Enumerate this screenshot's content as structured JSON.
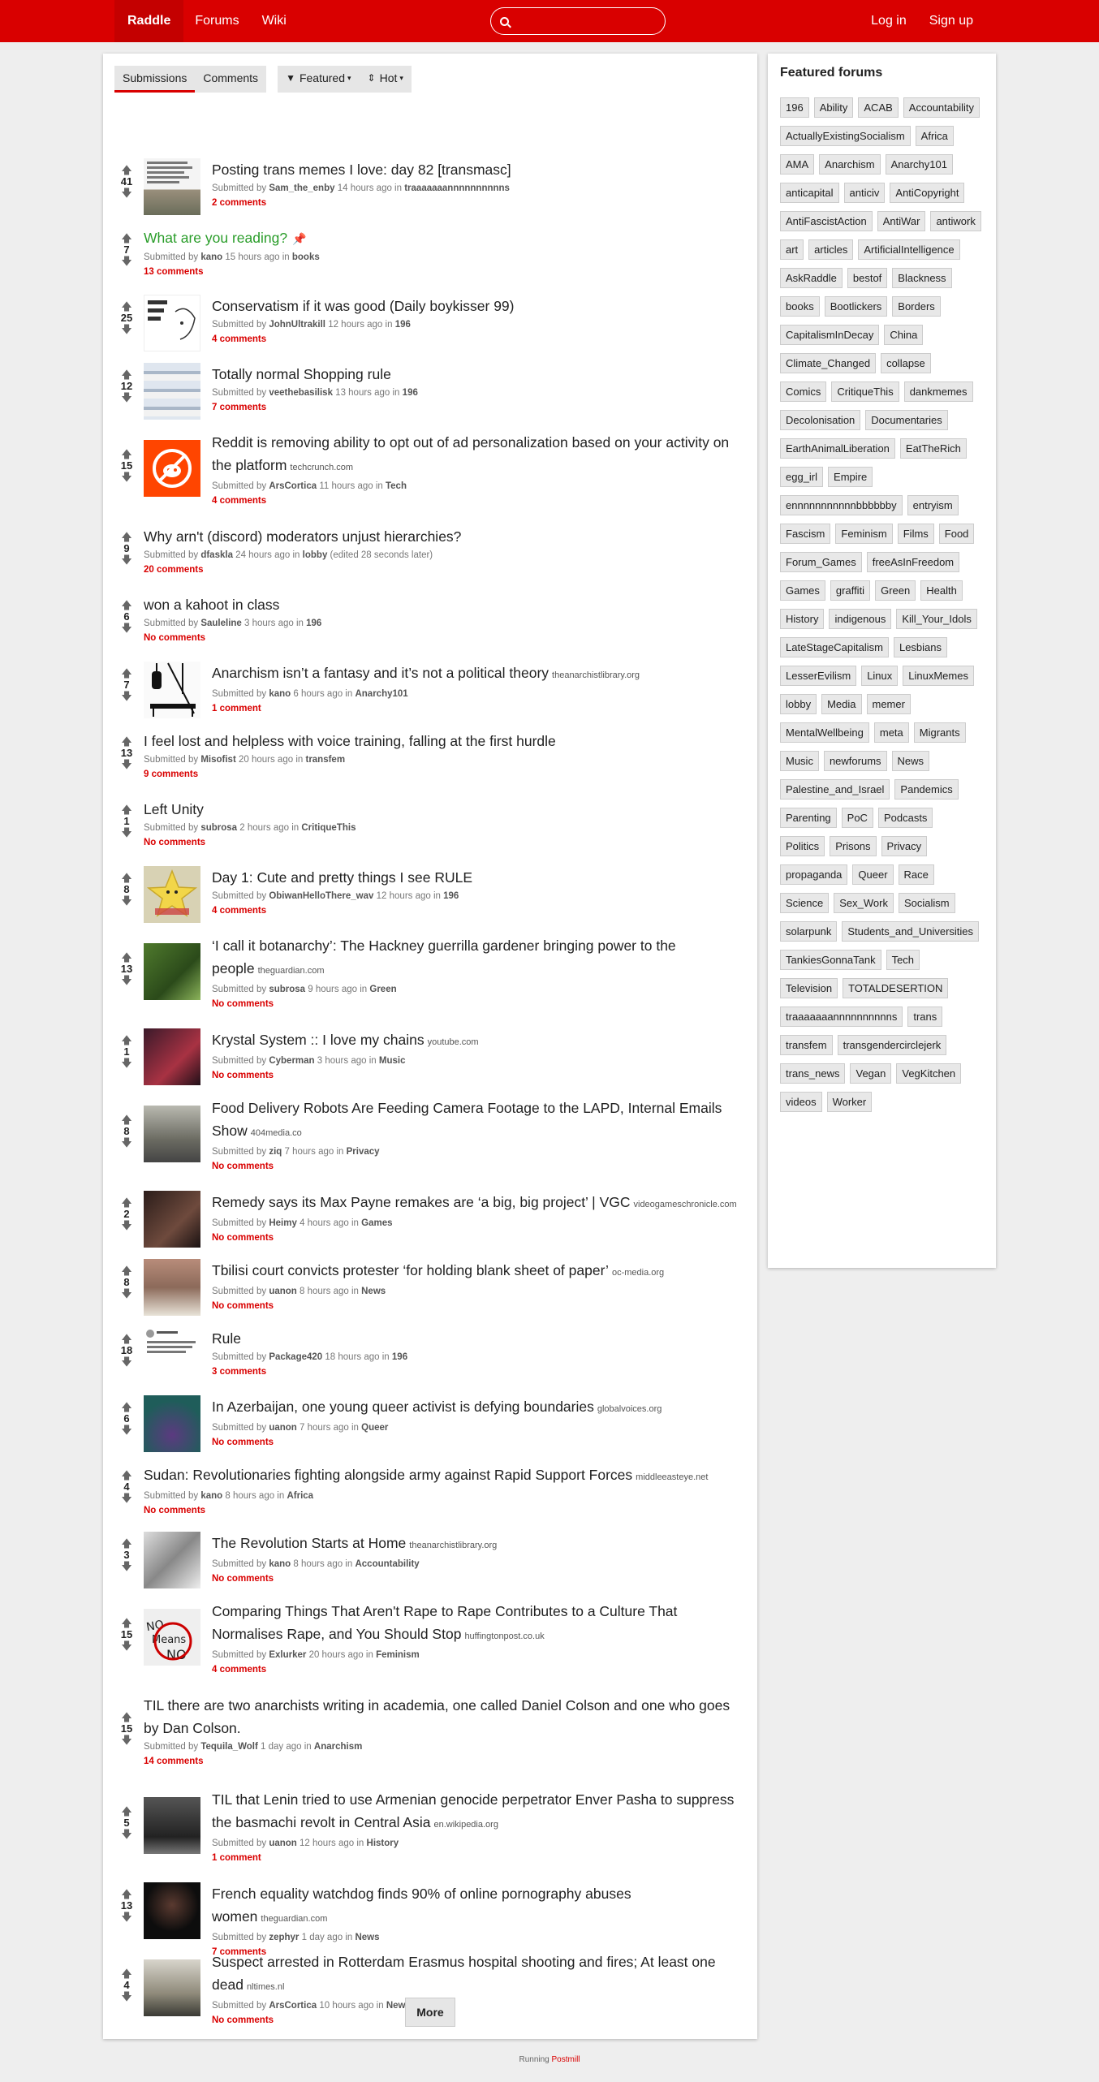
{
  "nav": {
    "brand": "Raddle",
    "forums": "Forums",
    "wiki": "Wiki",
    "login": "Log in",
    "signup": "Sign up",
    "search_placeholder": ""
  },
  "tabs": {
    "submissions": "Submissions",
    "comments": "Comments",
    "featured": "Featured",
    "hot": "Hot"
  },
  "posts": [
    {
      "score": "41",
      "title": "Posting trans memes I love: day 82 [transmasc]",
      "domain": "",
      "submitted": "Submitted by",
      "user": "Sam_the_enby",
      "time": "14 hours ago in",
      "forum": "traaaaaaannnnnnnnnns",
      "edited": "",
      "comments": "2 comments",
      "thumb": "memes"
    },
    {
      "score": "7",
      "title": "What are you reading?",
      "domain": "",
      "submitted": "Submitted by",
      "user": "kano",
      "time": "15 hours ago in",
      "forum": "books",
      "edited": "",
      "comments": "13 comments",
      "thumb": "",
      "pinned": true
    },
    {
      "score": "25",
      "title": "Conservatism if it was good (Daily boykisser 99)",
      "domain": "",
      "submitted": "Submitted by",
      "user": "JohnUltrakill",
      "time": "12 hours ago in",
      "forum": "196",
      "edited": "",
      "comments": "4 comments",
      "thumb": "sketch"
    },
    {
      "score": "12",
      "title": "Totally normal Shopping rule",
      "domain": "",
      "submitted": "Submitted by",
      "user": "veethebasilisk",
      "time": "13 hours ago in",
      "forum": "196",
      "edited": "",
      "comments": "7 comments",
      "thumb": "screens"
    },
    {
      "score": "15",
      "title": "Reddit is removing ability to opt out of ad personalization based on your activity on the platform",
      "domain": "techcrunch.com",
      "submitted": "Submitted by",
      "user": "ArsCortica",
      "time": "11 hours ago in",
      "forum": "Tech",
      "edited": "",
      "comments": "4 comments",
      "thumb": "reddit"
    },
    {
      "score": "9",
      "title": "Why arn't (discord) moderators unjust hierarchies?",
      "domain": "",
      "submitted": "Submitted by",
      "user": "dfaskla",
      "time": "24 hours ago in",
      "forum": "lobby",
      "edited": "(edited 28 seconds later)",
      "comments": "20 comments",
      "thumb": ""
    },
    {
      "score": "6",
      "title": "won a kahoot in class",
      "domain": "",
      "submitted": "Submitted by",
      "user": "Sauleline",
      "time": "3 hours ago in",
      "forum": "196",
      "edited": "",
      "comments": "No comments",
      "thumb": ""
    },
    {
      "score": "7",
      "title": "Anarchism isn’t a fantasy and it’s not a political theory",
      "domain": "theanarchistlibrary.org",
      "submitted": "Submitted by",
      "user": "kano",
      "time": "6 hours ago in",
      "forum": "Anarchy101",
      "edited": "",
      "comments": "1 comment",
      "thumb": "bw"
    },
    {
      "score": "13",
      "title": "I feel lost and helpless with voice training, falling at the first hurdle",
      "domain": "",
      "submitted": "Submitted by",
      "user": "Misofist",
      "time": "20 hours ago in",
      "forum": "transfem",
      "edited": "",
      "comments": "9 comments",
      "thumb": ""
    },
    {
      "score": "1",
      "title": "Left Unity",
      "domain": "",
      "submitted": "Submitted by",
      "user": "subrosa",
      "time": "2 hours ago in",
      "forum": "CritiqueThis",
      "edited": "",
      "comments": "No comments",
      "thumb": ""
    },
    {
      "score": "8",
      "title": "Day 1: Cute and pretty things I see RULE",
      "domain": "",
      "submitted": "Submitted by",
      "user": "ObiwanHelloThere_wav",
      "time": "12 hours ago in",
      "forum": "196",
      "edited": "",
      "comments": "4 comments",
      "thumb": "star"
    },
    {
      "score": "13",
      "title": "‘I call it botanarchy’: The Hackney guerrilla gardener bringing power to the people",
      "domain": "theguardian.com",
      "submitted": "Submitted by",
      "user": "subrosa",
      "time": "9 hours ago in",
      "forum": "Green",
      "edited": "",
      "comments": "No comments",
      "thumb": "garden"
    },
    {
      "score": "1",
      "title": "Krystal System :: I love my chains",
      "domain": "youtube.com",
      "submitted": "Submitted by",
      "user": "Cyberman",
      "time": "3 hours ago in",
      "forum": "Music",
      "edited": "",
      "comments": "No comments",
      "thumb": "music"
    },
    {
      "score": "8",
      "title": "Food Delivery Robots Are Feeding Camera Footage to the LAPD, Internal Emails Show",
      "domain": "404media.co",
      "submitted": "Submitted by",
      "user": "ziq",
      "time": "7 hours ago in",
      "forum": "Privacy",
      "edited": "",
      "comments": "No comments",
      "thumb": "robots"
    },
    {
      "score": "2",
      "title": "Remedy says its Max Payne remakes are ‘a big, big project’ | VGC",
      "domain": "videogameschronicle.com",
      "submitted": "Submitted by",
      "user": "Heimy",
      "time": "4 hours ago in",
      "forum": "Games",
      "edited": "",
      "comments": "No comments",
      "thumb": "game"
    },
    {
      "score": "8",
      "title": "Tbilisi court convicts protester ‘for holding blank sheet of paper’",
      "domain": "oc-media.org",
      "submitted": "Submitted by",
      "user": "uanon",
      "time": "8 hours ago in",
      "forum": "News",
      "edited": "",
      "comments": "No comments",
      "thumb": "protest"
    },
    {
      "score": "18",
      "title": "Rule",
      "domain": "",
      "submitted": "Submitted by",
      "user": "Package420",
      "time": "18 hours ago in",
      "forum": "196",
      "edited": "",
      "comments": "3 comments",
      "thumb": "tweet"
    },
    {
      "score": "6",
      "title": "In Azerbaijan, one young queer activist is defying boundaries",
      "domain": "globalvoices.org",
      "submitted": "Submitted by",
      "user": "uanon",
      "time": "7 hours ago in",
      "forum": "Queer",
      "edited": "",
      "comments": "No comments",
      "thumb": "queer"
    },
    {
      "score": "4",
      "title": "Sudan: Revolutionaries fighting alongside army against Rapid Support Forces",
      "domain": "middleeasteye.net",
      "submitted": "Submitted by",
      "user": "kano",
      "time": "8 hours ago in",
      "forum": "Africa",
      "edited": "",
      "comments": "No comments",
      "thumb": ""
    },
    {
      "score": "3",
      "title": "The Revolution Starts at Home",
      "domain": "theanarchistlibrary.org",
      "submitted": "Submitted by",
      "user": "kano",
      "time": "8 hours ago in",
      "forum": "Accountability",
      "edited": "",
      "comments": "No comments",
      "thumb": "bw2"
    },
    {
      "score": "15",
      "title": "Comparing Things That Aren't Rape to Rape Contributes to a Culture That Normalises Rape, and You Should Stop",
      "domain": "huffingtonpost.co.uk",
      "submitted": "Submitted by",
      "user": "Exlurker",
      "time": "20 hours ago in",
      "forum": "Feminism",
      "edited": "",
      "comments": "4 comments",
      "thumb": "nomeans"
    },
    {
      "score": "15",
      "title": "TIL there are two anarchists writing in academia, one called Daniel Colson and one who goes by Dan Colson.",
      "domain": "",
      "submitted": "Submitted by",
      "user": "Tequila_Wolf",
      "time": "1 day ago in",
      "forum": "Anarchism",
      "edited": "",
      "comments": "14 comments",
      "thumb": ""
    },
    {
      "score": "5",
      "title": "TIL that Lenin tried to use Armenian genocide perpetrator Enver Pasha to suppress the basmachi revolt in Central Asia",
      "domain": "en.wikipedia.org",
      "submitted": "Submitted by",
      "user": "uanon",
      "time": "12 hours ago in",
      "forum": "History",
      "edited": "",
      "comments": "1 comment",
      "thumb": "portrait"
    },
    {
      "score": "13",
      "title": "French equality watchdog finds 90% of online pornography abuses women",
      "domain": "theguardian.com",
      "submitted": "Submitted by",
      "user": "zephyr",
      "time": "1 day ago in",
      "forum": "News",
      "edited": "",
      "comments": "7 comments",
      "thumb": "dark"
    },
    {
      "score": "4",
      "title": "Suspect arrested in Rotterdam Erasmus hospital shooting and fires; At least one dead",
      "domain": "nltimes.nl",
      "submitted": "Submitted by",
      "user": "ArsCortica",
      "time": "10 hours ago in",
      "forum": "News",
      "edited": "",
      "comments": "No comments",
      "thumb": "police"
    }
  ],
  "more": "More",
  "sidebar": {
    "title": "Featured forums",
    "forums": [
      "196",
      "Ability",
      "ACAB",
      "Accountability",
      "ActuallyExistingSocialism",
      "Africa",
      "AMA",
      "Anarchism",
      "Anarchy101",
      "anticapital",
      "anticiv",
      "AntiCopyright",
      "AntiFascistAction",
      "AntiWar",
      "antiwork",
      "art",
      "articles",
      "ArtificialIntelligence",
      "AskRaddle",
      "bestof",
      "Blackness",
      "books",
      "Bootlickers",
      "Borders",
      "CapitalismInDecay",
      "China",
      "Climate_Changed",
      "collapse",
      "Comics",
      "CritiqueThis",
      "dankmemes",
      "Decolonisation",
      "Documentaries",
      "EarthAnimalLiberation",
      "EatTheRich",
      "egg_irl",
      "Empire",
      "ennnnnnnnnnnbbbbbby",
      "entryism",
      "Fascism",
      "Feminism",
      "Films",
      "Food",
      "Forum_Games",
      "freeAsInFreedom",
      "Games",
      "graffiti",
      "Green",
      "Health",
      "History",
      "indigenous",
      "Kill_Your_Idols",
      "LateStageCapitalism",
      "Lesbians",
      "LesserEvilism",
      "Linux",
      "LinuxMemes",
      "lobby",
      "Media",
      "memer",
      "MentalWellbeing",
      "meta",
      "Migrants",
      "Music",
      "newforums",
      "News",
      "Palestine_and_Israel",
      "Pandemics",
      "Parenting",
      "PoC",
      "Podcasts",
      "Politics",
      "Prisons",
      "Privacy",
      "propaganda",
      "Queer",
      "Race",
      "Science",
      "Sex_Work",
      "Socialism",
      "solarpunk",
      "Students_and_Universities",
      "TankiesGonnaTank",
      "Tech",
      "Television",
      "TOTALDESERTION",
      "traaaaaaannnnnnnnnns",
      "trans",
      "transfem",
      "transgendercirclejerk",
      "trans_news",
      "Vegan",
      "VegKitchen",
      "videos",
      "Worker"
    ]
  },
  "footer": {
    "running": "Running",
    "link": "Postmill"
  }
}
